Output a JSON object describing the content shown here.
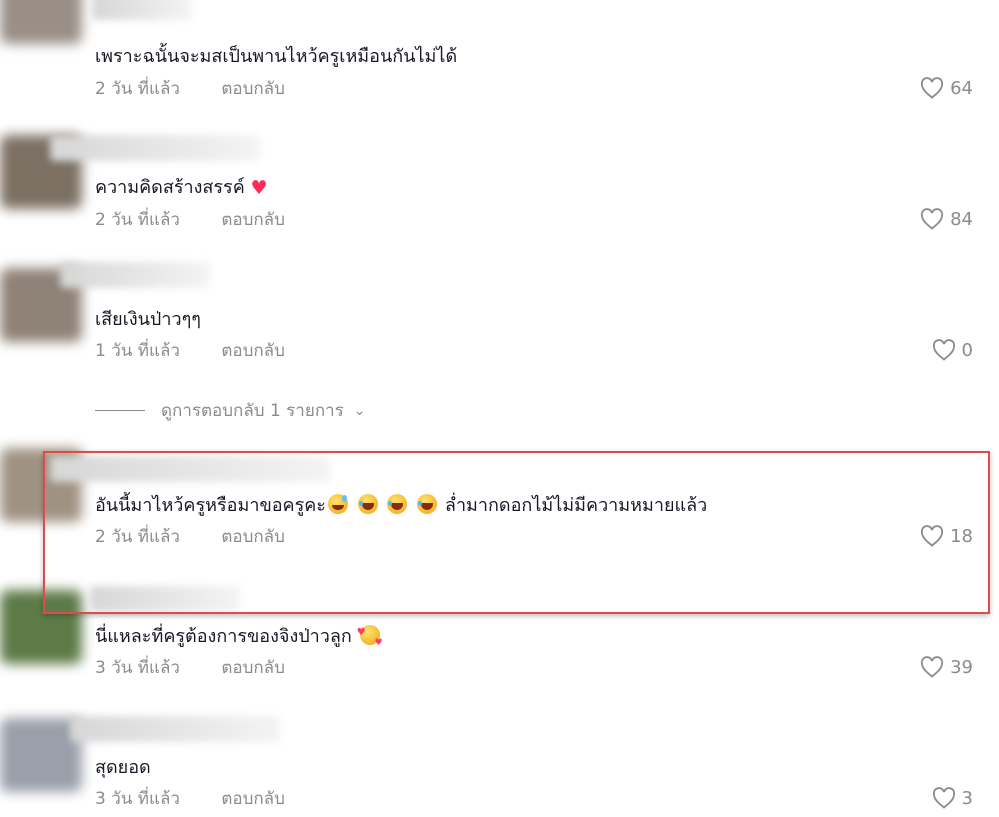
{
  "reply_label": "ตอบกลับ",
  "comments": [
    {
      "text": "เพราะฉนั้นจะมสเป็นพานไหว้ครูเหมือนกันไม่ได้",
      "time": "2 วัน ที่แล้ว",
      "likes": "64"
    },
    {
      "text": "ความคิดสร้างสรรค์",
      "time": "2 วัน ที่แล้ว",
      "likes": "84"
    },
    {
      "text": "เสียเงินป่าวๆๆ",
      "time": "1 วัน ที่แล้ว",
      "likes": "0"
    },
    {
      "text_before": "อันนี้มาไหว้ครูหรือมาขอครูคะ",
      "text_after": "ล่ำมากดอกไม้ไม่มีความหมายแล้ว",
      "time": "2 วัน ที่แล้ว",
      "likes": "18"
    },
    {
      "text": "นี่แหละที่ครูต้องการของจิงป่าวลูก",
      "time": "3 วัน ที่แล้ว",
      "likes": "39"
    },
    {
      "text": "สุดยอด",
      "time": "3 วัน ที่แล้ว",
      "likes": "3"
    }
  ],
  "view_replies": "ดูการตอบกลับ 1 รายการ",
  "icons": {
    "like": "heart-outline-icon",
    "expand": "chevron-down-icon"
  },
  "colors": {
    "text": "#161823",
    "muted": "#8a8b91",
    "highlight": "#e04a4a",
    "heart_emoji": "#fe2c55"
  }
}
